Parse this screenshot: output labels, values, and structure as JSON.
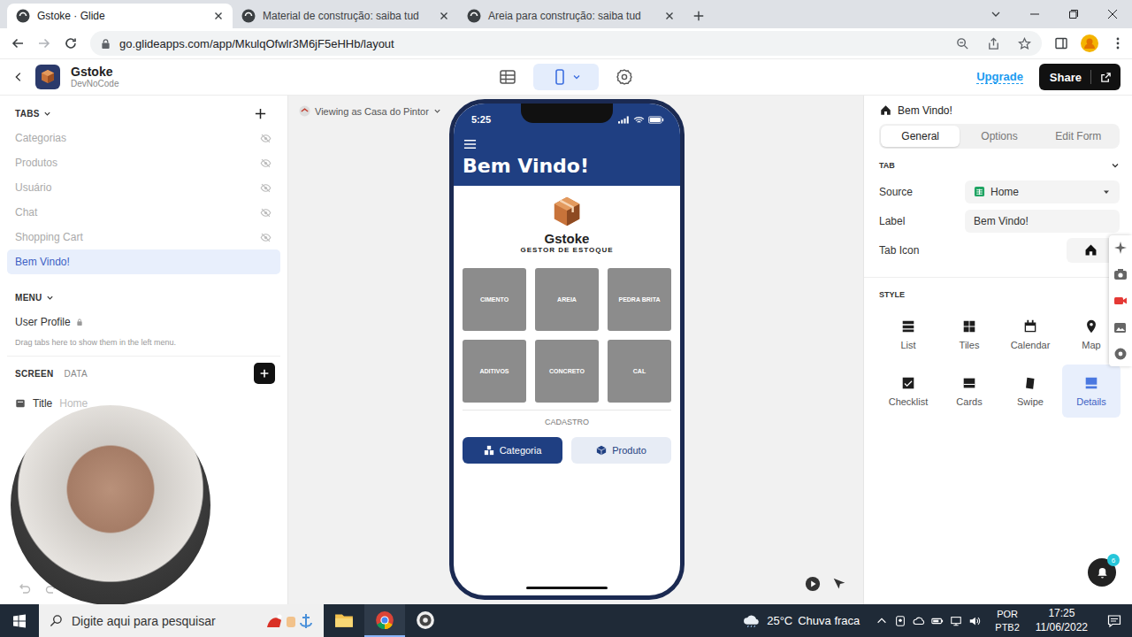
{
  "browser": {
    "tabs": [
      {
        "title": "Gstoke · Glide",
        "selected": true
      },
      {
        "title": "Material de construção: saiba tud",
        "selected": false
      },
      {
        "title": "Areia para construção: saiba tud",
        "selected": false
      }
    ],
    "url": "go.glideapps.com/app/MkulqOfwlr3M6jF5eHHb/layout"
  },
  "app_header": {
    "name": "Gstoke",
    "subtitle": "DevNoCode",
    "views": [
      {
        "kind": "data",
        "selected": false
      },
      {
        "kind": "layout",
        "selected": true
      },
      {
        "kind": "settings",
        "selected": false
      }
    ],
    "upgrade": "Upgrade",
    "share": "Share"
  },
  "left_panel": {
    "tabs_heading": "TABS",
    "tabs": [
      {
        "label": "Categorias",
        "hidden": true,
        "selected": false
      },
      {
        "label": "Produtos",
        "hidden": true,
        "selected": false
      },
      {
        "label": "Usuário",
        "hidden": true,
        "selected": false
      },
      {
        "label": "Chat",
        "hidden": true,
        "selected": false
      },
      {
        "label": "Shopping Cart",
        "hidden": true,
        "selected": false
      },
      {
        "label": "Bem Vindo!",
        "hidden": false,
        "selected": true
      }
    ],
    "menu_heading": "MENU",
    "menu_items": [
      {
        "label": "User Profile",
        "locked": true
      }
    ],
    "menu_hint": "Drag tabs here to show them in the left menu.",
    "screen_tabs": [
      {
        "label": "SCREEN",
        "selected": true
      },
      {
        "label": "DATA",
        "selected": false
      }
    ],
    "components": [
      {
        "label": "Title",
        "detail": "Home"
      }
    ]
  },
  "canvas": {
    "viewing_as": "Viewing as Casa do Pintor"
  },
  "phone": {
    "time": "5:25",
    "title": "Bem Vindo!",
    "logo_name": "Gstoke",
    "logo_tagline": "GESTOR DE ESTOQUE",
    "tiles": [
      "CIMENTO",
      "AREIA",
      "PEDRA BRITA",
      "ADITIVOS",
      "CONCRETO",
      "CAL"
    ],
    "section": "CADASTRO",
    "buttons": [
      {
        "label": "Categoria",
        "primary": true,
        "kind": "category"
      },
      {
        "label": "Produto",
        "primary": false,
        "kind": "product"
      }
    ]
  },
  "right_panel": {
    "title": "Bem Vindo!",
    "segments": [
      {
        "label": "General",
        "selected": true
      },
      {
        "label": "Options",
        "selected": false
      },
      {
        "label": "Edit Form",
        "selected": false
      }
    ],
    "tab_heading": "TAB",
    "source": {
      "label": "Source",
      "value": "Home"
    },
    "label_field": {
      "label": "Label",
      "value": "Bem Vindo!"
    },
    "tab_icon": {
      "label": "Tab Icon"
    },
    "style_heading": "STYLE",
    "styles": [
      {
        "label": "List",
        "kind": "list",
        "selected": false
      },
      {
        "label": "Tiles",
        "kind": "tiles",
        "selected": false
      },
      {
        "label": "Calendar",
        "kind": "calendar",
        "selected": false
      },
      {
        "label": "Map",
        "kind": "map",
        "selected": false
      },
      {
        "label": "Checklist",
        "kind": "checklist",
        "selected": false
      },
      {
        "label": "Cards",
        "kind": "cards",
        "selected": false
      },
      {
        "label": "Swipe",
        "kind": "swipe",
        "selected": false
      },
      {
        "label": "Details",
        "kind": "details",
        "selected": true
      }
    ]
  },
  "notifications": {
    "count": "6"
  },
  "taskbar": {
    "search_placeholder": "Digite aqui para pesquisar",
    "apps": [
      {
        "kind": "explorer",
        "active": false
      },
      {
        "kind": "chrome",
        "active": true
      },
      {
        "kind": "recorder",
        "active": false
      }
    ],
    "weather": {
      "temp": "25°C",
      "text": "Chuva fraca"
    },
    "language": "POR",
    "layout": "PTB2",
    "time": "17:25",
    "date": "11/06/2022"
  }
}
